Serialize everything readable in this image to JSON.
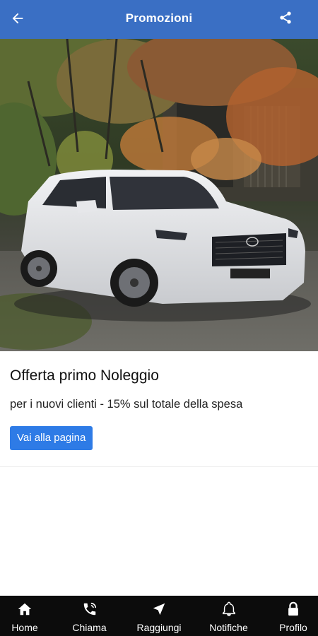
{
  "header": {
    "title": "Promozioni",
    "back_icon": "arrow-left-icon",
    "share_icon": "share-icon",
    "background": "#3a6fc4"
  },
  "promo": {
    "title": "Offerta primo Noleggio",
    "description": "per i nuovi clienti - 15% sul totale della spesa",
    "button_label": "Vai alla pagina",
    "button_color": "#2e7be6"
  },
  "bottom_nav": {
    "items": [
      {
        "label": "Home",
        "icon": "home-icon"
      },
      {
        "label": "Chiama",
        "icon": "phone-icon"
      },
      {
        "label": "Raggiungi",
        "icon": "navigation-arrow-icon"
      },
      {
        "label": "Notifiche",
        "icon": "bell-icon"
      },
      {
        "label": "Profilo",
        "icon": "lock-icon"
      }
    ]
  }
}
